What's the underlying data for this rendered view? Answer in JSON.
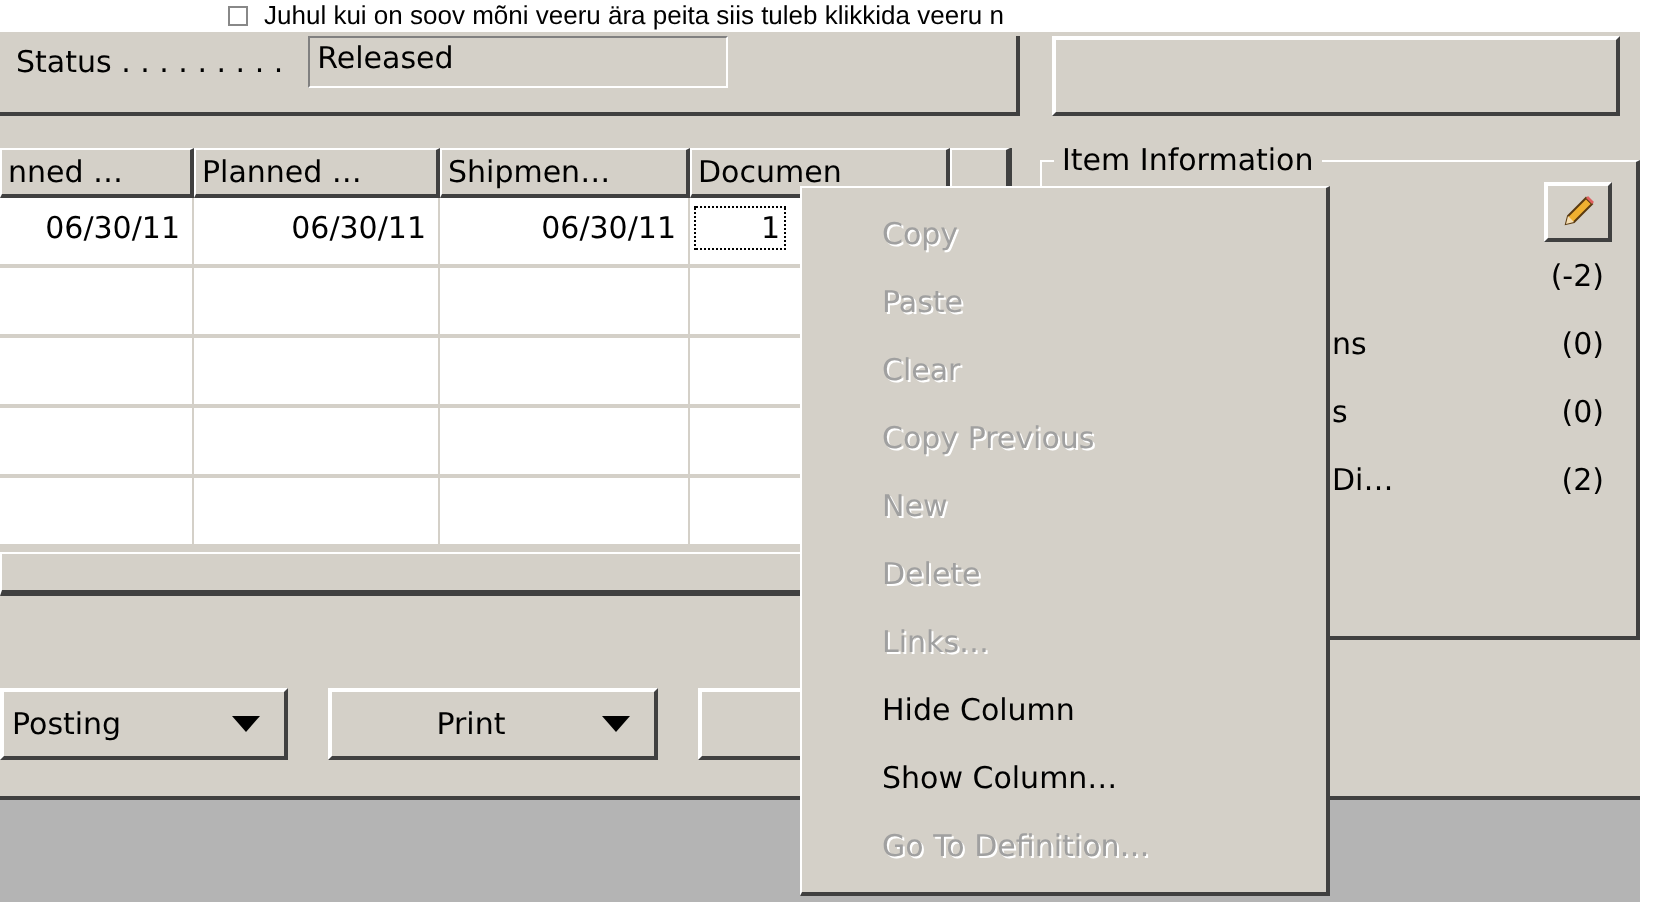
{
  "document_line": {
    "text": "Juhul kui on soov mõni veeru ära peita siis tuleb klikkida veeru n"
  },
  "status": {
    "label": "Status . . . . . . . . .",
    "value": "Released"
  },
  "table": {
    "columns": [
      "nned …",
      "Planned …",
      "Shipmen…",
      "Documen",
      ""
    ],
    "rows": [
      {
        "cells": [
          {
            "text": "06/30/11",
            "focused": false
          },
          {
            "text": "06/30/11",
            "focused": false
          },
          {
            "text": "06/30/11",
            "focused": false
          },
          {
            "text": "1",
            "focused": true
          }
        ]
      }
    ]
  },
  "item_information": {
    "title": "Item Information",
    "rows": [
      {
        "count": "(-2)"
      },
      {
        "label": "ns",
        "count": "(0)"
      },
      {
        "label": "s",
        "count": "(0)"
      },
      {
        "label": "Di…",
        "count": "(2)"
      }
    ]
  },
  "buttons": [
    {
      "kind": "dropdown",
      "label": "Posting"
    },
    {
      "kind": "dropdown",
      "label": "Print"
    },
    {
      "kind": "plain"
    }
  ],
  "context_menu": [
    {
      "label": "Copy",
      "disabled": true
    },
    {
      "label": "Paste",
      "disabled": true
    },
    {
      "label": "Clear",
      "disabled": true
    },
    {
      "label": "Copy Previous",
      "disabled": true
    },
    {
      "label": "New",
      "disabled": true
    },
    {
      "label": "Delete",
      "disabled": true
    },
    {
      "label": "Links…",
      "disabled": true
    },
    {
      "label": "Hide Column",
      "disabled": false
    },
    {
      "label": "Show Column…",
      "disabled": false
    },
    {
      "label": "Go To Definition…",
      "disabled": true
    }
  ]
}
